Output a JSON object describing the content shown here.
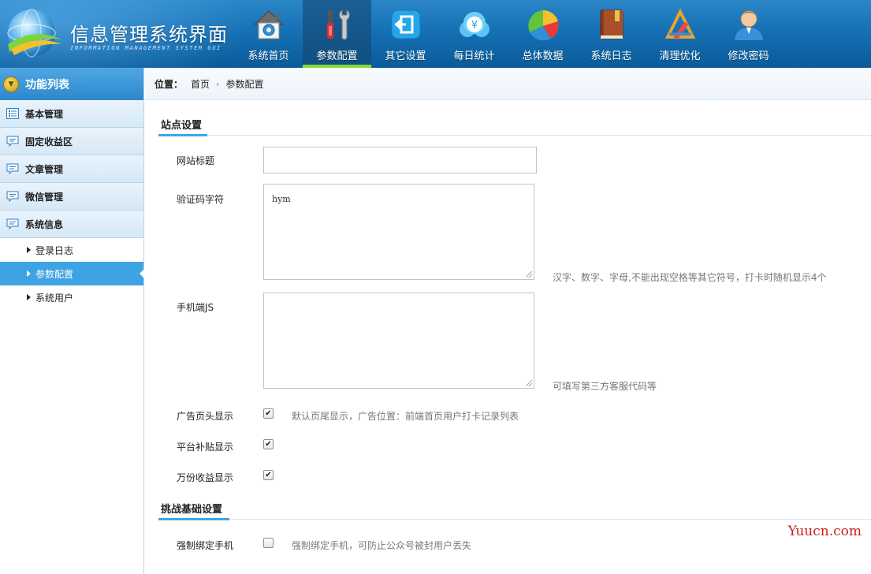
{
  "brand": {
    "title": "信息管理系统界面",
    "subtitle": "INFORMATION MANAGEMENT SYSTEM GUI"
  },
  "nav": [
    {
      "label": "系统首页",
      "icon": "home-icon"
    },
    {
      "label": "参数配置",
      "icon": "tools-icon",
      "active": true
    },
    {
      "label": "其它设置",
      "icon": "exit-icon"
    },
    {
      "label": "每日统计",
      "icon": "money-cloud-icon"
    },
    {
      "label": "总体数据",
      "icon": "pie-chart-icon"
    },
    {
      "label": "系统日志",
      "icon": "book-icon"
    },
    {
      "label": "清理优化",
      "icon": "pencil-ruler-icon"
    },
    {
      "label": "修改密码",
      "icon": "user-icon"
    }
  ],
  "sidebar": {
    "header": "功能列表",
    "groups": [
      {
        "label": "基本管理",
        "icon": "list-icon"
      },
      {
        "label": "固定收益区",
        "icon": "comment-icon"
      },
      {
        "label": "文章管理",
        "icon": "comment-icon"
      },
      {
        "label": "微信管理",
        "icon": "comment-icon"
      },
      {
        "label": "系统信息",
        "icon": "comment-icon"
      }
    ],
    "subitems": [
      {
        "label": "登录日志"
      },
      {
        "label": "参数配置",
        "active": true
      },
      {
        "label": "系统用户"
      }
    ]
  },
  "breadcrumb": {
    "label": "位置：",
    "home": "首页",
    "separator": "›",
    "current": "参数配置"
  },
  "site_settings": {
    "title": "站点设置",
    "site_title_label": "网站标题",
    "site_title_value": "",
    "captcha_label": "验证码字符",
    "captcha_value": "hym",
    "captcha_hint": "汉字、数字、字母,不能出现空格等其它符号，打卡时随机显示4个",
    "mobile_js_label": "手机端JS",
    "mobile_js_value": "",
    "mobile_js_hint": "可填写第三方客服代码等",
    "ad_header_label": "广告页头显示",
    "ad_header_checked": true,
    "ad_header_hint": "默认页尾显示，广告位置：前端首页用户打卡记录列表",
    "subsidy_label": "平台补贴显示",
    "subsidy_checked": true,
    "earnings_label": "万份收益显示",
    "earnings_checked": true
  },
  "challenge_settings": {
    "title": "挑战基础设置",
    "bind_phone_label": "强制绑定手机",
    "bind_phone_checked": false,
    "bind_phone_hint": "强制绑定手机，可防止公众号被封用户丢失"
  },
  "watermark": "Yuucn.com",
  "colors": {
    "header": "#1670b4",
    "active_nav": "#0f4f80",
    "active_accent": "#8bd83a",
    "sidebar_active": "#3da3e2",
    "section_accent": "#3ea7e3"
  }
}
